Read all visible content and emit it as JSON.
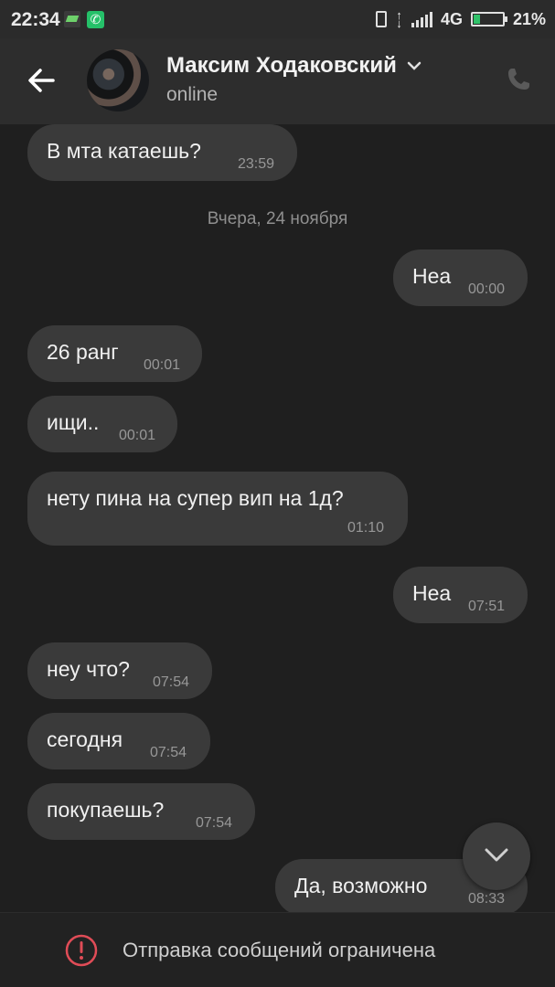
{
  "status_bar": {
    "time": "22:34",
    "network": "4G",
    "battery": "21%",
    "battery_level": 0.21,
    "icons": [
      "notification-app-icon",
      "phone-call-icon",
      "vibrate-icon",
      "data-arrows-icon",
      "signal-icon",
      "battery-icon"
    ]
  },
  "header": {
    "contact_name": "Максим Ходаковский",
    "presence": "online",
    "icons": [
      "back-arrow-icon",
      "chevron-down-icon",
      "phone-icon"
    ]
  },
  "colors": {
    "background": "#1f1f1f",
    "header": "#2d2d2d",
    "bubble": "#3a3a3a",
    "warning": "#e04c57"
  },
  "messages": [
    {
      "text": "В мта катаешь?",
      "time": "23:59",
      "direction": "incoming"
    },
    {
      "text": "Неа",
      "time": "00:00",
      "direction": "outgoing"
    },
    {
      "text": "26 ранг",
      "time": "00:01",
      "direction": "incoming"
    },
    {
      "text": "ищи..",
      "time": "00:01",
      "direction": "incoming"
    },
    {
      "text": "нету пина на супер вип на 1д?",
      "time": "01:10",
      "direction": "incoming"
    },
    {
      "text": "Неа",
      "time": "07:51",
      "direction": "outgoing"
    },
    {
      "text": "неу что?",
      "time": "07:54",
      "direction": "incoming"
    },
    {
      "text": "сегодня",
      "time": "07:54",
      "direction": "incoming"
    },
    {
      "text": "покупаешь?",
      "time": "07:54",
      "direction": "incoming"
    },
    {
      "text": "Да, возможно",
      "time": "08:33",
      "direction": "outgoing"
    }
  ],
  "date_separator": "Вчера, 24 ноября",
  "footer": {
    "restriction_text": "Отправка сообщений ограничена"
  }
}
